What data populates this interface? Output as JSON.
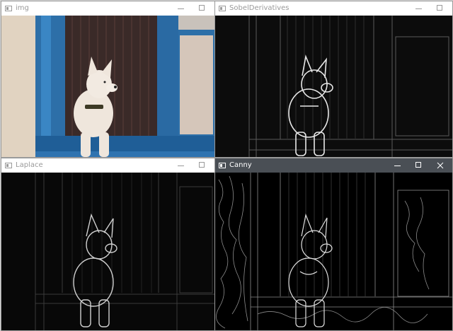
{
  "windows": [
    {
      "title": "img",
      "min_label": "minimize",
      "max_label": "maximize"
    },
    {
      "title": "SobelDerivatives",
      "min_label": "minimize",
      "max_label": "maximize"
    },
    {
      "title": "Laplace",
      "min_label": "minimize",
      "max_label": "maximize"
    },
    {
      "title": "Canny",
      "min_label": "minimize",
      "max_label": "maximize",
      "close_label": "close"
    }
  ],
  "colors": {
    "titlebar_inactive": "#ffffff",
    "titlebar_active": "#4a4f55",
    "window_frame": "#2d6fa8",
    "wall": "#d8c9b6",
    "dog": "#efe6dc"
  },
  "icons": [
    "opencv-window-icon",
    "minimize-icon",
    "maximize-icon",
    "close-icon"
  ]
}
